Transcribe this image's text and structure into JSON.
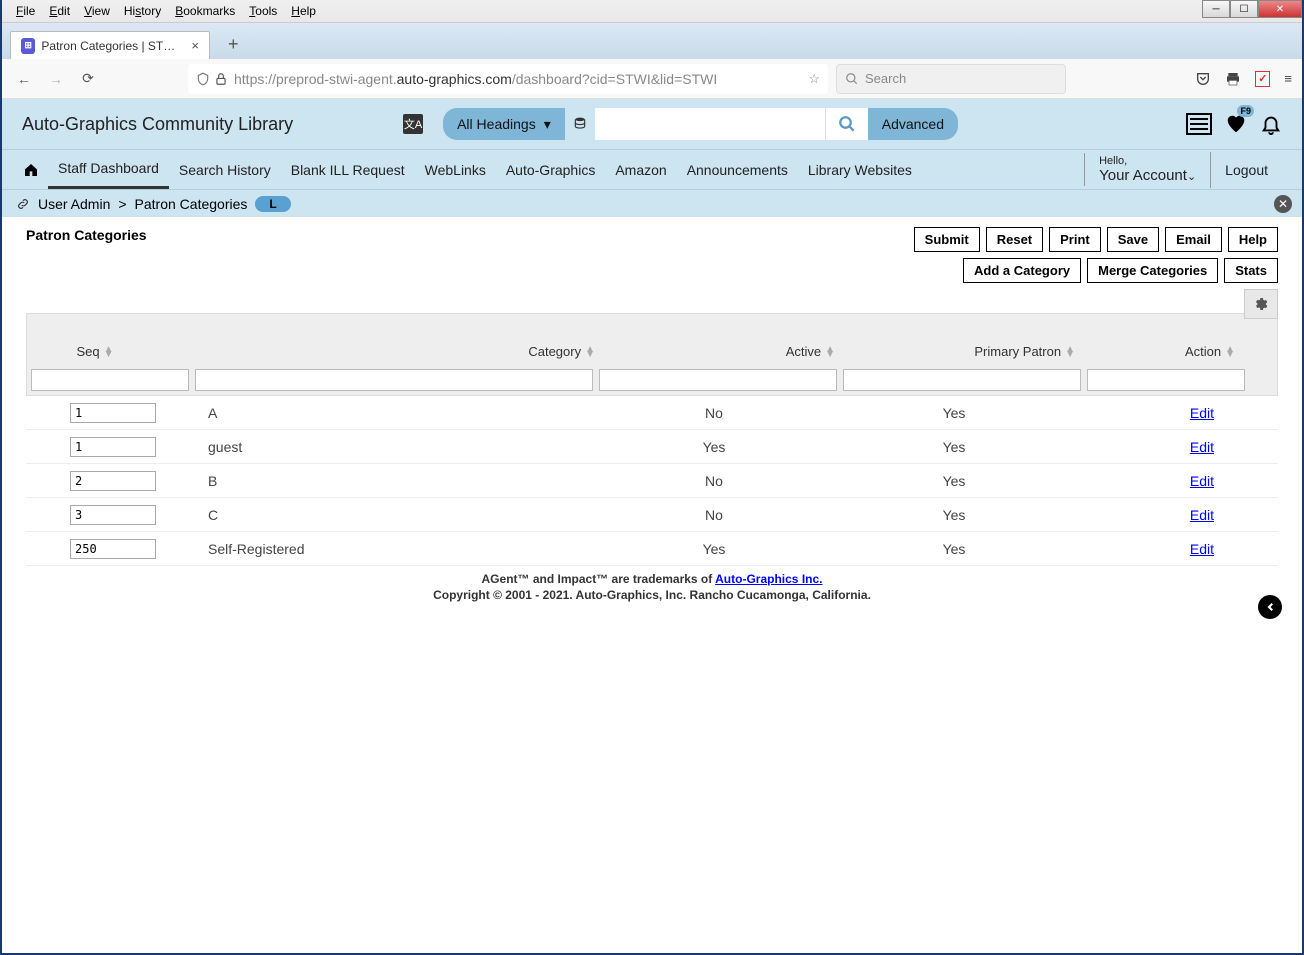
{
  "browser": {
    "menus": [
      "File",
      "Edit",
      "View",
      "History",
      "Bookmarks",
      "Tools",
      "Help"
    ],
    "tab_title": "Patron Categories | STWI | stwi |",
    "url_prefix": "https://preprod-stwi-agent.",
    "url_domain": "auto-graphics.com",
    "url_path": "/dashboard?cid=STWI&lid=STWI",
    "search_placeholder": "Search"
  },
  "header": {
    "brand": "Auto-Graphics Community Library",
    "dropdown": "All Headings",
    "advanced": "Advanced",
    "f9": "F9"
  },
  "nav": {
    "items": [
      "Staff Dashboard",
      "Search History",
      "Blank ILL Request",
      "WebLinks",
      "Auto-Graphics",
      "Amazon",
      "Announcements",
      "Library Websites"
    ],
    "hello": "Hello,",
    "account": "Your Account",
    "logout": "Logout"
  },
  "breadcrumb": {
    "part1": "User Admin",
    "sep": ">",
    "part2": "Patron Categories",
    "badge": "L"
  },
  "page": {
    "title": "Patron Categories",
    "buttons_row1": [
      "Submit",
      "Reset",
      "Print",
      "Save",
      "Email",
      "Help"
    ],
    "buttons_row2": [
      "Add a Category",
      "Merge Categories",
      "Stats"
    ]
  },
  "table": {
    "columns": [
      "Seq",
      "Category",
      "Active",
      "Primary Patron",
      "Action"
    ],
    "rows": [
      {
        "seq": "1",
        "category": "A",
        "active": "No",
        "primary": "Yes",
        "action": "Edit"
      },
      {
        "seq": "1",
        "category": "guest",
        "active": "Yes",
        "primary": "Yes",
        "action": "Edit"
      },
      {
        "seq": "2",
        "category": "B",
        "active": "No",
        "primary": "Yes",
        "action": "Edit"
      },
      {
        "seq": "3",
        "category": "C",
        "active": "No",
        "primary": "Yes",
        "action": "Edit"
      },
      {
        "seq": "250",
        "category": "Self-Registered",
        "active": "Yes",
        "primary": "Yes",
        "action": "Edit"
      }
    ]
  },
  "footer": {
    "line1a": "AGent™ and Impact™ are trademarks of ",
    "line1b": "Auto-Graphics Inc.",
    "line2": "Copyright © 2001 - 2021. Auto-Graphics, Inc. Rancho Cucamonga, California."
  }
}
